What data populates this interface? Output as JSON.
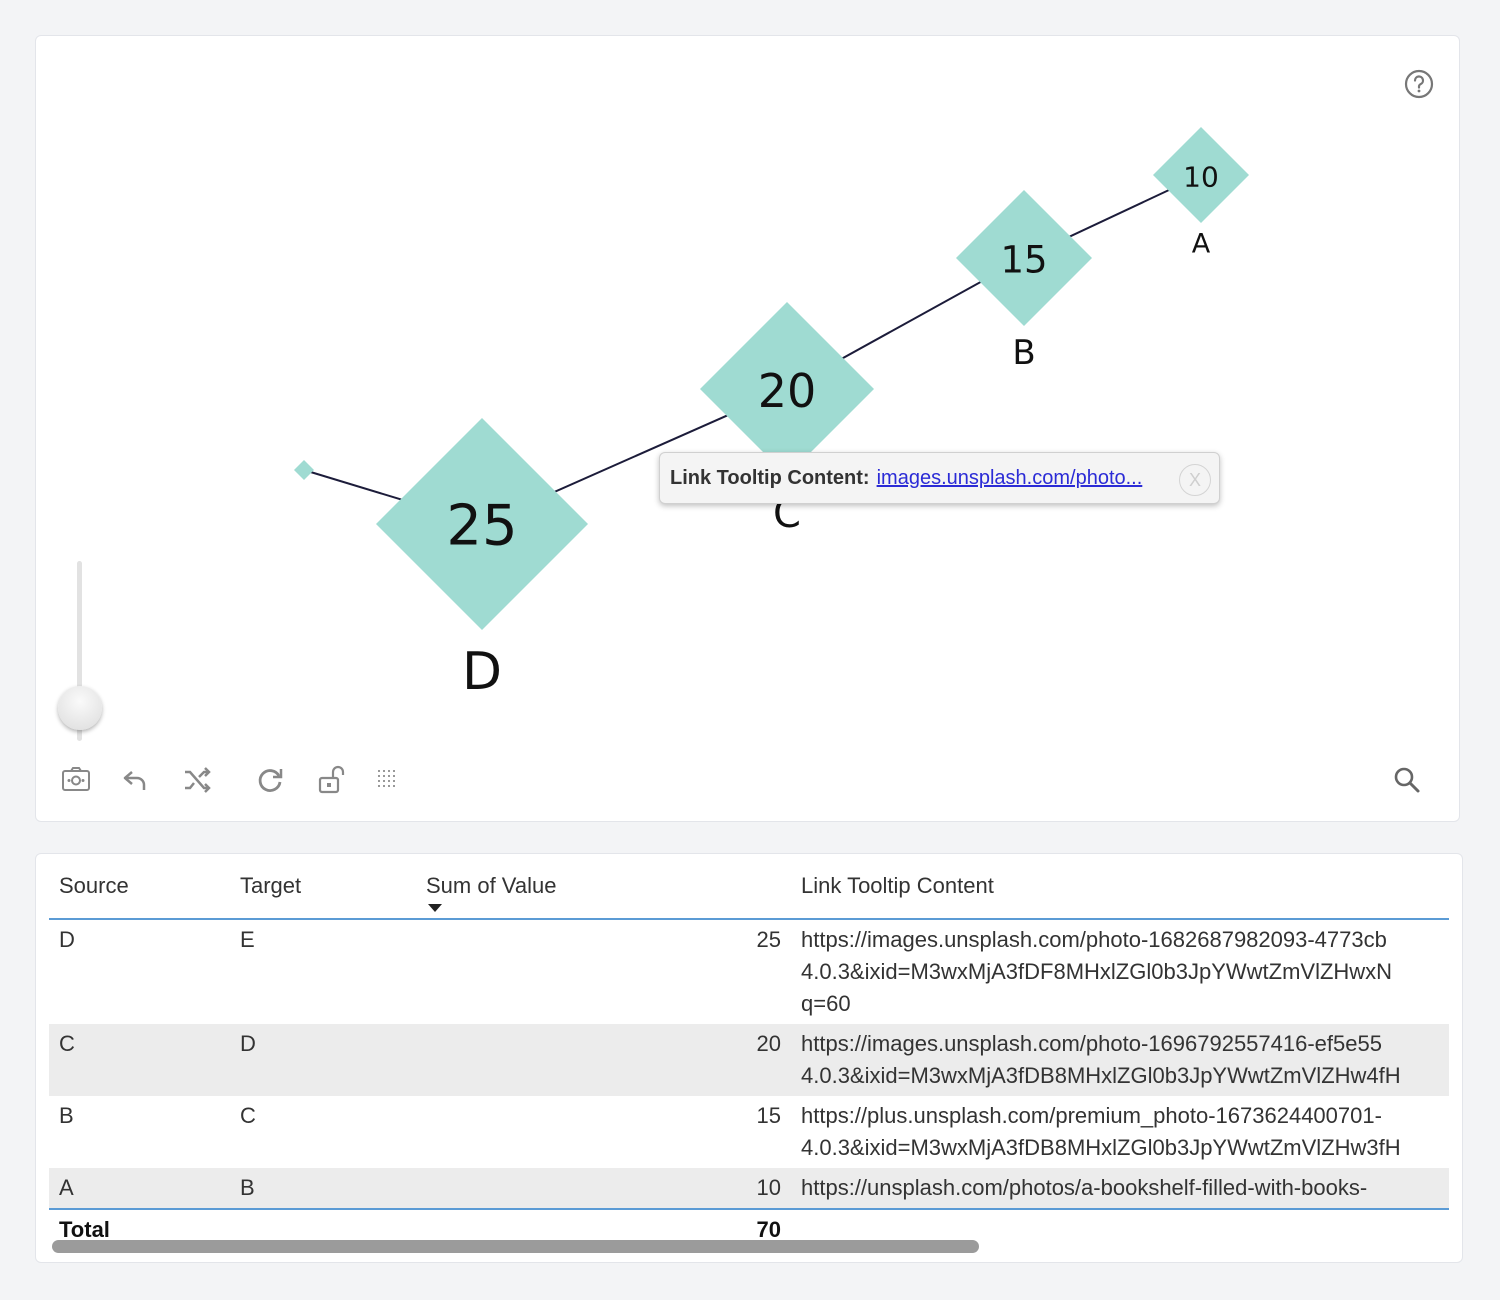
{
  "graph": {
    "nodes": [
      {
        "id": "D",
        "label": "D",
        "value": "25"
      },
      {
        "id": "C",
        "label": "C",
        "value": "20"
      },
      {
        "id": "B",
        "label": "B",
        "value": "15"
      },
      {
        "id": "A",
        "label": "A",
        "value": "10"
      },
      {
        "id": "E",
        "label": "",
        "value": ""
      }
    ],
    "links": [
      {
        "source": "D",
        "target": "E"
      },
      {
        "source": "C",
        "target": "D"
      },
      {
        "source": "B",
        "target": "C"
      },
      {
        "source": "A",
        "target": "B"
      }
    ],
    "node_color": "#9fdbd2",
    "tooltip": {
      "label": "Link Tooltip Content:",
      "link_text": "images.unsplash.com/photo...",
      "close": "X"
    }
  },
  "toolbar": {
    "icons": [
      "screenshot-icon",
      "undo-icon",
      "shuffle-icon",
      "refresh-icon",
      "unlock-icon",
      "grid-icon"
    ],
    "search": "search-icon",
    "help": "help-icon"
  },
  "table": {
    "headers": [
      "Source",
      "Target",
      "Sum of Value",
      "Link Tooltip Content"
    ],
    "sorted_column": "Sum of Value",
    "rows": [
      {
        "source": "D",
        "target": "E",
        "value": "25",
        "tooltip": "https://images.unsplash.com/photo-1682687982093-4773cb\n4.0.3&ixid=M3wxMjA3fDF8MHxlZGl0b3JpYWwtZmVlZHwxN\nq=60"
      },
      {
        "source": "C",
        "target": "D",
        "value": "20",
        "tooltip": "https://images.unsplash.com/photo-1696792557416-ef5e55\n4.0.3&ixid=M3wxMjA3fDB8MHxlZGl0b3JpYWwtZmVlZHw4fH"
      },
      {
        "source": "B",
        "target": "C",
        "value": "15",
        "tooltip": "https://plus.unsplash.com/premium_photo-1673624400701-\n4.0.3&ixid=M3wxMjA3fDB8MHxlZGl0b3JpYWwtZmVlZHw3fH"
      },
      {
        "source": "A",
        "target": "B",
        "value": "10",
        "tooltip": "https://unsplash.com/photos/a-bookshelf-filled-with-books-"
      }
    ],
    "total": {
      "label": "Total",
      "value": "70"
    }
  }
}
